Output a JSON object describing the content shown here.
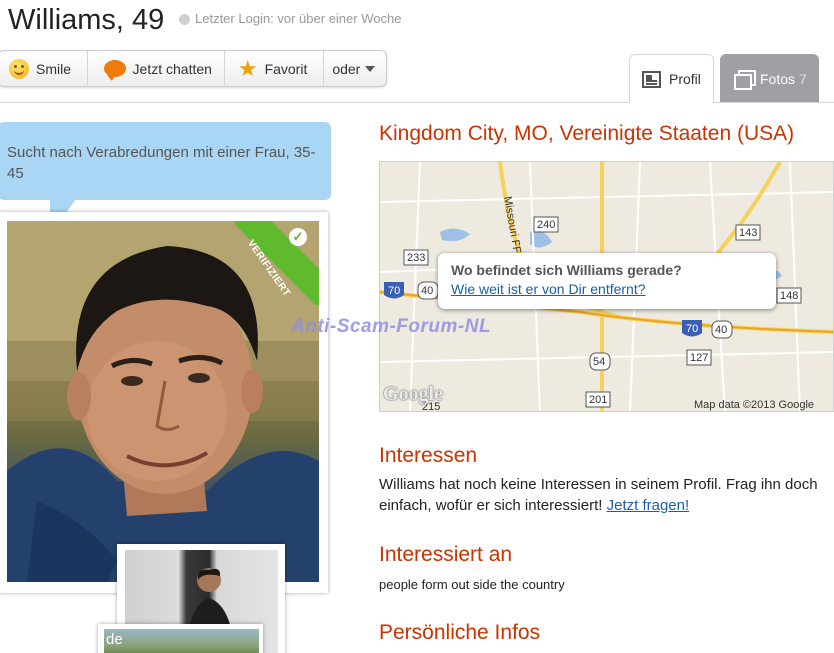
{
  "header": {
    "name": "Williams, 49",
    "last_login": "Letzter Login: vor über einer Woche"
  },
  "actions": {
    "smile": "Smile",
    "chat": "Jetzt chatten",
    "favorite": "Favorit",
    "more": "oder"
  },
  "tabs": {
    "profil": "Profil",
    "fotos": "Fotos",
    "fotos_count": "7"
  },
  "bubble": {
    "text": "Sucht nach Verabredungen mit einer Frau, 35-45"
  },
  "photo": {
    "verified_label": "VERIFIZIERT",
    "verified_check": "✓",
    "thumb2_label": "de"
  },
  "location": {
    "title": "Kingdom City, MO, Vereinigte Staaten (USA)"
  },
  "map": {
    "popup_title": "Wo befindet sich Williams gerade?",
    "popup_link": "Wie weit ist er von Dir entfernt?",
    "copyright": "Map data ©2013 Google",
    "logo": "Google",
    "road_labels": [
      "240",
      "233",
      "143",
      "148",
      "127",
      "54",
      "201",
      "215",
      "70",
      "40",
      "70",
      "40"
    ],
    "street_label": "Missouri FF"
  },
  "watermark": "Anti-Scam-Forum-NL",
  "interessen": {
    "heading": "Interessen",
    "text": "Williams hat noch keine Interessen in seinem Profil. Frag ihn doch einfach, wofür er sich interessiert!",
    "link": "Jetzt fragen!"
  },
  "interessiert_an": {
    "heading": "Interessiert an",
    "text": "people form out side the country"
  },
  "persoenlich": {
    "heading": "Persönliche Infos"
  },
  "colors": {
    "heading_red": "#cc3300",
    "link_blue": "#1a5fa8",
    "bubble_blue": "#a9d6f5",
    "verified_green": "#5fba2d"
  }
}
